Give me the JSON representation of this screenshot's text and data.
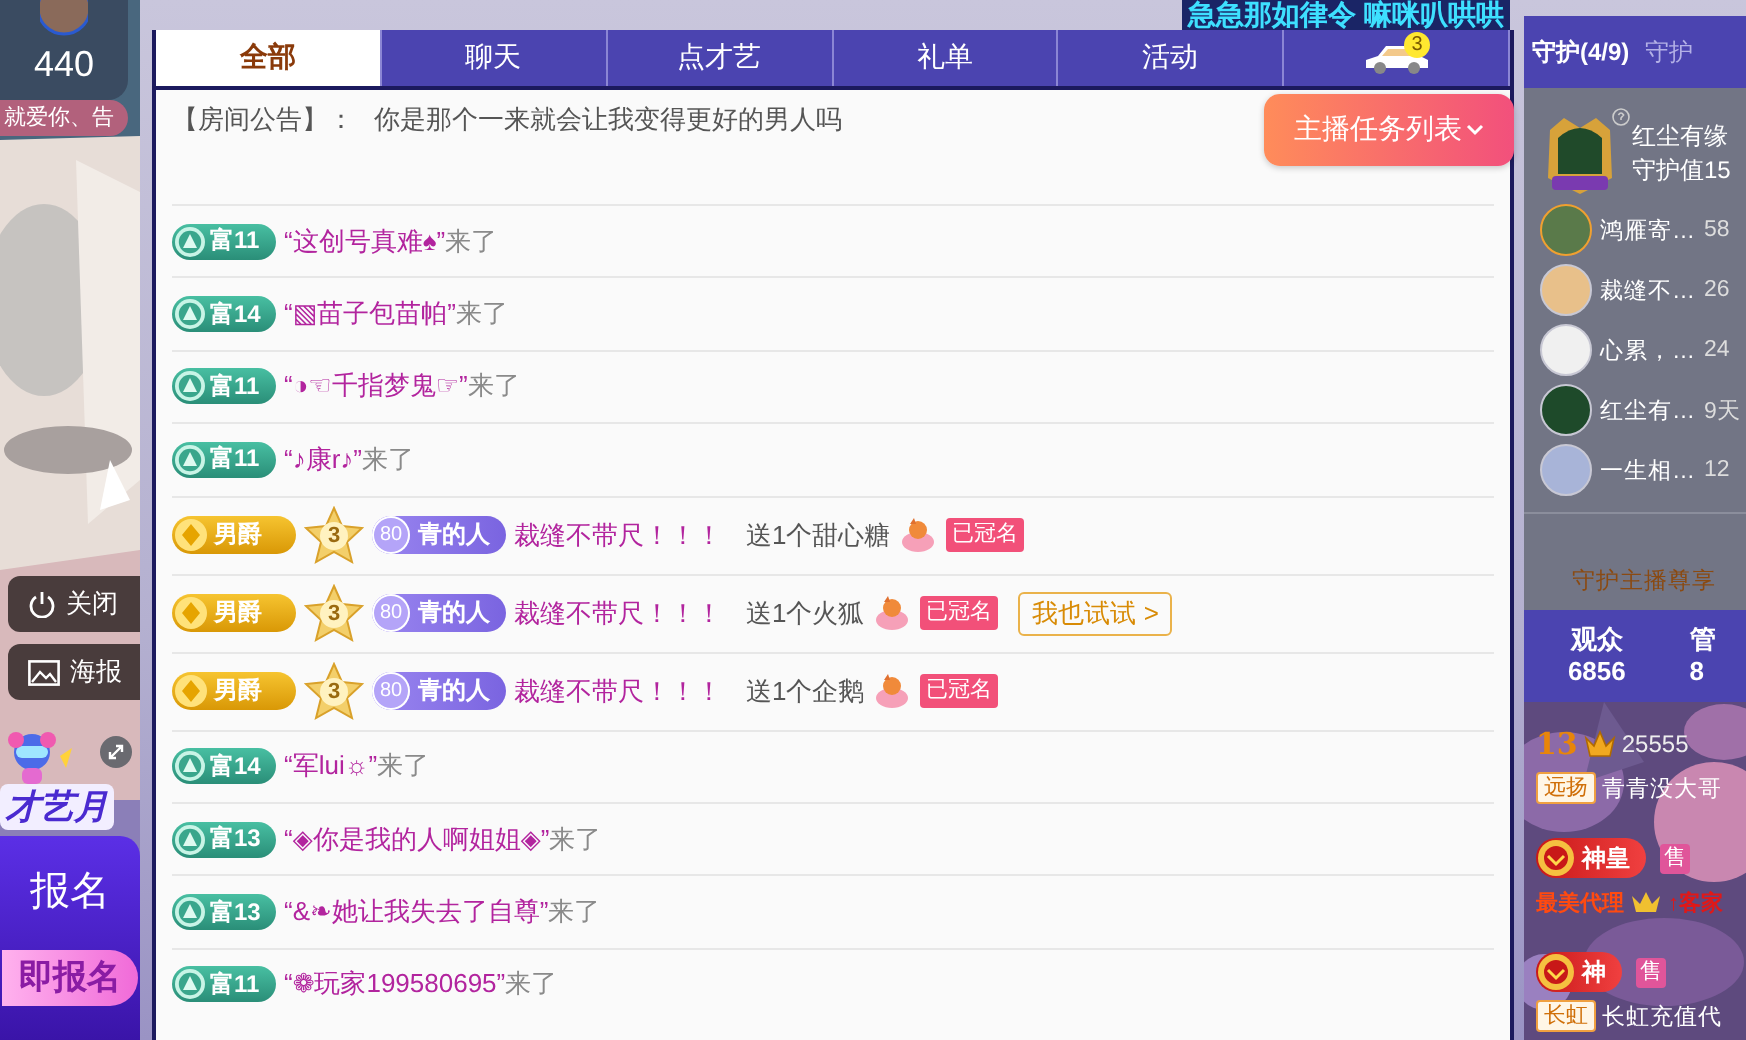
{
  "header_banner": "急急那如律令 嘛咪叭哄哄",
  "left": {
    "count": "440",
    "marquee": "就爱你、告",
    "buttons": [
      {
        "kind": "close",
        "label": "关闭"
      },
      {
        "kind": "poster",
        "label": "海报"
      }
    ],
    "promo": {
      "title": "才艺月",
      "subtitle": "报名",
      "button": "即报名"
    }
  },
  "tabs": [
    {
      "kind": "text",
      "label": "全部",
      "selected": true
    },
    {
      "kind": "text",
      "label": "聊天",
      "selected": false
    },
    {
      "kind": "text",
      "label": "点才艺",
      "selected": false
    },
    {
      "kind": "text",
      "label": "礼单",
      "selected": false
    },
    {
      "kind": "text",
      "label": "活动",
      "selected": false
    },
    {
      "kind": "car",
      "badge": "3",
      "selected": false
    }
  ],
  "announcement": {
    "label": "【房间公告】：",
    "text": "你是那个一来就会让我变得更好的男人吗"
  },
  "task_button": "主播任务列表",
  "messages": [
    {
      "kind": "enter",
      "level": "富11",
      "user": "“这创号真难♠”",
      "text": "来了"
    },
    {
      "kind": "enter",
      "level": "富14",
      "user": "“▧苗子包苗帕”",
      "text": "来了"
    },
    {
      "kind": "enter",
      "level": "富11",
      "user": "“◑☜千指梦鬼☞”",
      "text": "来了"
    },
    {
      "kind": "enter",
      "level": "富11",
      "user": "“♪康r♪”",
      "text": "来了"
    },
    {
      "kind": "gift",
      "noble": "男爵",
      "star": "3",
      "fan_level": "80",
      "fan_name": "青的人",
      "user": "裁缝不带尺！！！",
      "text": "送1个甜心糖",
      "tag": "已冠名"
    },
    {
      "kind": "gift",
      "noble": "男爵",
      "star": "3",
      "fan_level": "80",
      "fan_name": "青的人",
      "user": "裁缝不带尺！！！",
      "text": "送1个火狐",
      "tag": "已冠名",
      "action": "我也试试 >"
    },
    {
      "kind": "gift",
      "noble": "男爵",
      "star": "3",
      "fan_level": "80",
      "fan_name": "青的人",
      "user": "裁缝不带尺！！！",
      "text": "送1个企鹅",
      "tag": "已冠名"
    },
    {
      "kind": "enter",
      "level": "富14",
      "user": "“军lui☼”",
      "text": "来了"
    },
    {
      "kind": "enter",
      "level": "富13",
      "user": "“◈你是我的人啊姐姐◈”",
      "text": "来了"
    },
    {
      "kind": "enter",
      "level": "富13",
      "user": "“&❧她让我失去了自尊”",
      "text": "来了"
    },
    {
      "kind": "enter",
      "level": "富11",
      "user": "“❁玩家199580695”",
      "text": "来了"
    }
  ],
  "side": {
    "tabs": [
      {
        "label": "守护(4/9)",
        "selected": true
      },
      {
        "label": "守护",
        "selected": false
      }
    ],
    "top_guardian": {
      "name": "红尘有缘",
      "value": "守护值15"
    },
    "guardians": [
      {
        "name": "鸿雁寄…",
        "days": "58"
      },
      {
        "name": "裁缝不…",
        "days": "26"
      },
      {
        "name": "心累，…",
        "days": "24"
      },
      {
        "name": "红尘有…",
        "days": "9天"
      },
      {
        "name": "一生相…",
        "days": "12"
      }
    ],
    "privilege": "守护主播尊享",
    "stats": [
      {
        "label": "观众",
        "value": "6856"
      },
      {
        "label": "管",
        "value": "8"
      }
    ],
    "chat": [
      {
        "kind": "level",
        "level": "13",
        "score": "25555",
        "tag": "远扬",
        "text": "青青没大哥"
      },
      {
        "kind": "badge",
        "badge": "神皇",
        "sale": "售",
        "title": "最美代理",
        "text": "↑客家"
      },
      {
        "kind": "badge",
        "badge": "神",
        "sale": "售",
        "tag": "长虹",
        "text": "长虹充值代"
      }
    ]
  }
}
